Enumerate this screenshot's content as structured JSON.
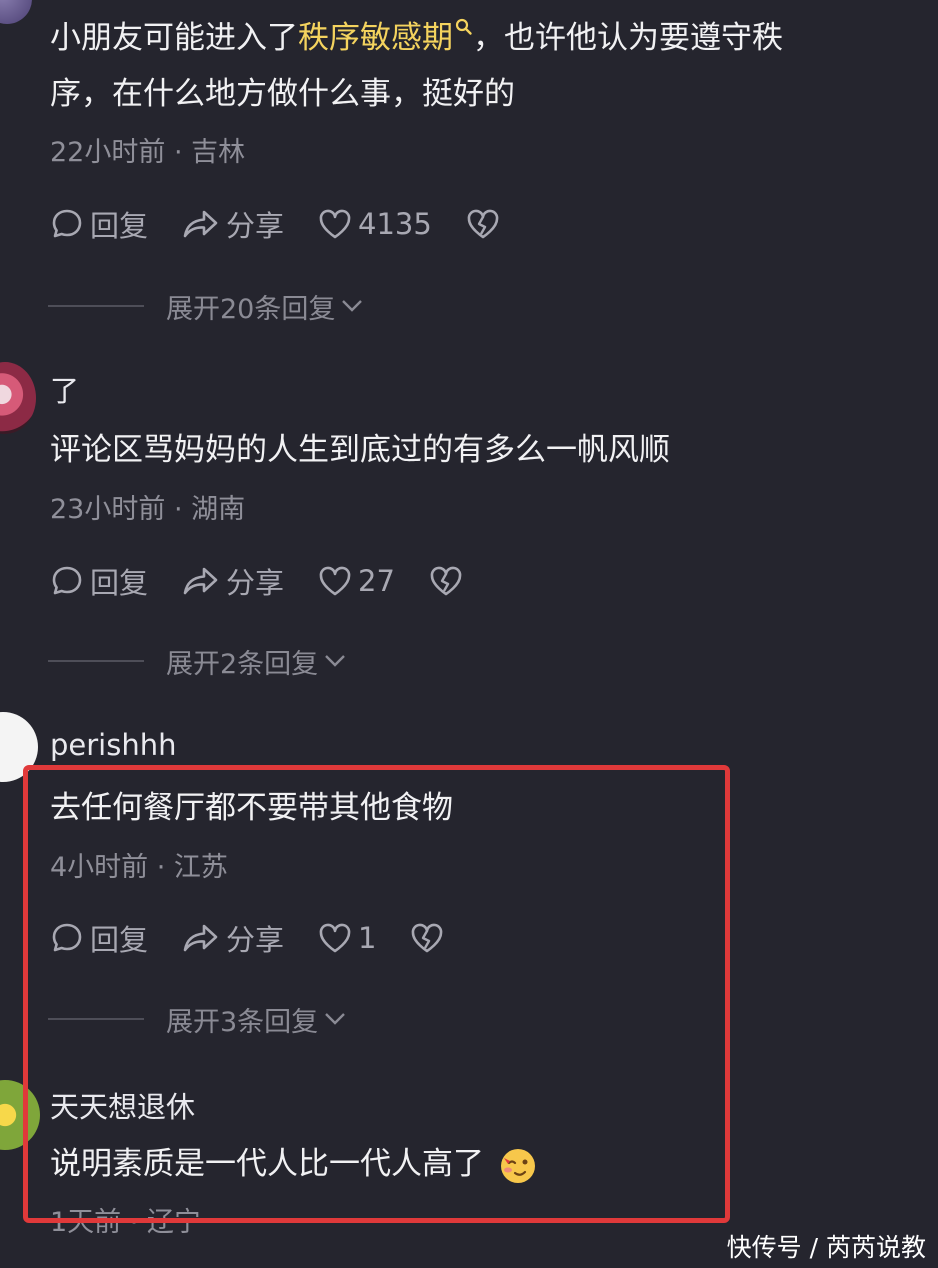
{
  "comments": [
    {
      "text_before": "小朋友可能进入了",
      "keyword": "秩序敏感期",
      "text_after_line1": "，也许他认为要遵守秩",
      "text_line2": "序，在什么地方做什么事，挺好的",
      "meta": "22小时前 · 吉林",
      "reply_label": "回复",
      "share_label": "分享",
      "likes": "4135",
      "expand": "展开20条回复"
    },
    {
      "username": "了",
      "text": "评论区骂妈妈的人生到底过的有多么一帆风顺",
      "meta": "23小时前 · 湖南",
      "reply_label": "回复",
      "share_label": "分享",
      "likes": "27",
      "expand": "展开2条回复"
    },
    {
      "username": "perishhh",
      "text": "去任何餐厅都不要带其他食物",
      "meta": "4小时前 · 江苏",
      "reply_label": "回复",
      "share_label": "分享",
      "likes": "1",
      "expand": "展开3条回复"
    },
    {
      "username": "天天想退休",
      "text": "说明素质是一代人比一代人高了",
      "meta": "1天前 · 辽宁"
    }
  ],
  "watermark": "快传号 / 芮芮说教",
  "colors": {
    "background": "#25252e",
    "keyword": "#f4d35e",
    "highlight_border": "#e0393a"
  },
  "icons": [
    "comment-icon",
    "share-icon",
    "heart-icon",
    "broken-heart-icon",
    "search-icon",
    "chevron-down-icon",
    "wink-emoji"
  ]
}
